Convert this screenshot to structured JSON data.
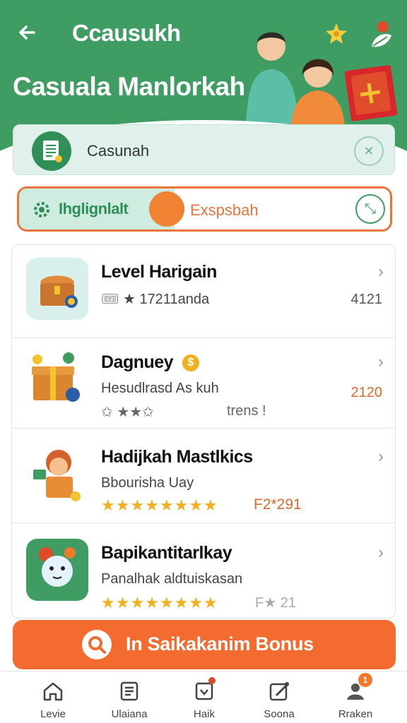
{
  "header": {
    "app_title": "Ccausukh",
    "hero_title": "Casuala Manlorkah"
  },
  "search": {
    "text": "Casunah"
  },
  "toggle": {
    "left_label": "Ihglignlalt",
    "right_label": "Exspsbah"
  },
  "list": {
    "items": [
      {
        "title": "Level Harigain",
        "subtitle": "★ 17211anda",
        "value": "4121",
        "stars": null
      },
      {
        "title": "Dagnuey",
        "subtitle": "Hesudlrasd As kuh",
        "meta": "✩ ★★✩",
        "meta2": "trens !",
        "value": "2120"
      },
      {
        "title": "Hadijkah Mastlkics",
        "subtitle": "Bbourisha Uay",
        "rating_text": "F2*291",
        "value": ""
      },
      {
        "title": "Bapikantitarlkay",
        "subtitle": "Panalhak aldtuiskasan",
        "rating_text": "F★ 21",
        "value": ""
      }
    ]
  },
  "cta": {
    "label": "In Saikakanim Bonus"
  },
  "nav": {
    "items": [
      {
        "label": "Levie"
      },
      {
        "label": "Ulaiana"
      },
      {
        "label": "Haik"
      },
      {
        "label": "Soona"
      },
      {
        "label": "Rraken",
        "badge": "1"
      }
    ]
  },
  "colors": {
    "brand_green": "#3f9c62",
    "accent_orange": "#f36b2f",
    "star_gold": "#f2b01e"
  }
}
